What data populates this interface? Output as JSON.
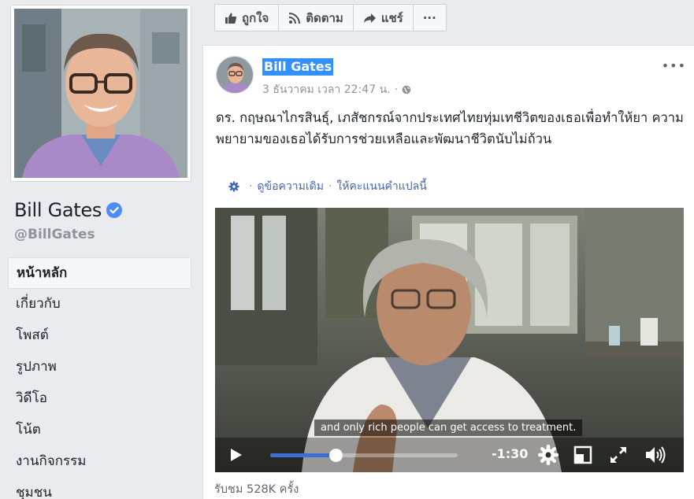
{
  "profile": {
    "name": "Bill Gates",
    "handle": "@BillGates"
  },
  "nav": {
    "items": [
      {
        "label": "หน้าหลัก",
        "active": true
      },
      {
        "label": "เกี่ยวกับ"
      },
      {
        "label": "โพสต์"
      },
      {
        "label": "รูปภาพ"
      },
      {
        "label": "วิดีโอ"
      },
      {
        "label": "โน้ต"
      },
      {
        "label": "งานกิจกรรม"
      },
      {
        "label": "ชุมชน"
      }
    ]
  },
  "actions": {
    "like": "ถูกใจ",
    "follow": "ติดตาม",
    "share": "แชร์",
    "more": "···"
  },
  "post": {
    "author": "Bill Gates",
    "timestamp": "3 ธันวาคม เวลา 22:47 น.",
    "separator": "·",
    "more": "•••",
    "text": "ดร. กฤษณาไกรสินธุ์, เภสัชกรณ์จากประเทศไทยทุ่มเทชีวิตของเธอเพื่อทำให้ยา ความพยายามของเธอได้รับการช่วยเหลือและพัฒนาชีวิตนับไม่ถ้วน",
    "see_original": "ดูข้อความเดิม",
    "rate_translation": "ให้คะแนนคำแปลนี้",
    "translate_sep": "·"
  },
  "video": {
    "subtitle": "and only rich people can get access to treatment.",
    "time_remaining": "-1:30",
    "progress": 0.35
  },
  "views": "รับชม 528K ครั้ง",
  "colors": {
    "accent": "#4267b2",
    "highlight": "#3390ff",
    "progress": "#3b6fd6"
  }
}
